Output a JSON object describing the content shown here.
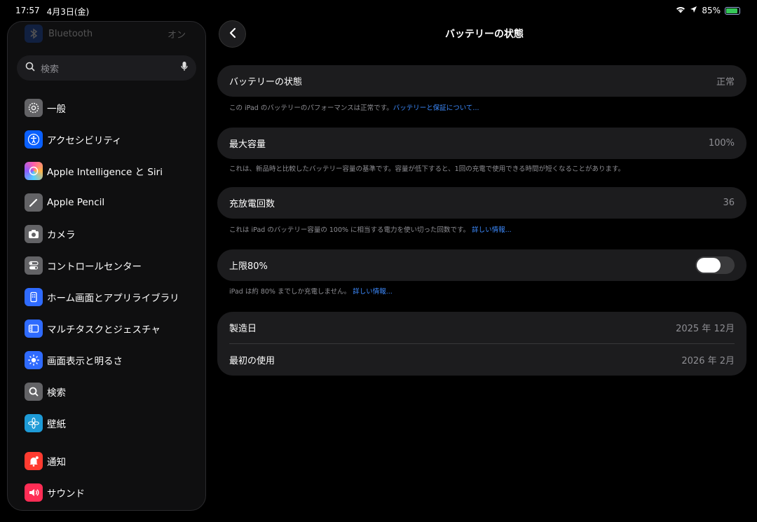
{
  "status": {
    "time": "17:57",
    "date": "4月3日(金)",
    "battery": "85%",
    "battery_level": 0.85
  },
  "sidebar": {
    "bluetooth": {
      "label": "Bluetooth",
      "value": "オン"
    },
    "search_placeholder": "検索",
    "items": [
      {
        "label": "一般",
        "icon": "gear-icon",
        "color": "#636366"
      },
      {
        "label": "アクセシビリティ",
        "icon": "accessibility-icon",
        "color": "#0a60ff"
      },
      {
        "label": "Apple Intelligence と Siri",
        "icon": "siri-icon",
        "color": "#e05ac0"
      },
      {
        "label": "Apple Pencil",
        "icon": "pencil-icon",
        "color": "#636366"
      },
      {
        "label": "カメラ",
        "icon": "camera-icon",
        "color": "#636366"
      },
      {
        "label": "コントロールセンター",
        "icon": "switches-icon",
        "color": "#636366"
      },
      {
        "label": "ホーム画面とアプリライブラリ",
        "icon": "home-screen-icon",
        "color": "#2f6bff"
      },
      {
        "label": "マルチタスクとジェスチャ",
        "icon": "multitask-icon",
        "color": "#2f6bff"
      },
      {
        "label": "画面表示と明るさ",
        "icon": "sun-icon",
        "color": "#2f6bff"
      },
      {
        "label": "検索",
        "icon": "magnifier-icon",
        "color": "#636366"
      },
      {
        "label": "壁紙",
        "icon": "flower-icon",
        "color": "#1e9bd7"
      },
      {
        "label": "通知",
        "icon": "bell-icon",
        "color": "#ff3b30"
      },
      {
        "label": "サウンド",
        "icon": "speaker-icon",
        "color": "#ff2d55"
      }
    ]
  },
  "main": {
    "title": "バッテリーの状態",
    "health": {
      "label": "バッテリーの状態",
      "value": "正常",
      "note": "この iPad のバッテリーのパフォーマンスは正常です。",
      "link": "バッテリーと保証について..."
    },
    "capacity": {
      "label": "最大容量",
      "value": "100%",
      "note": "これは、新品時と比較したバッテリー容量の基準です。容量が低下すると、1回の充電で使用できる時間が短くなることがあります。"
    },
    "cycles": {
      "label": "充放電回数",
      "value": "36",
      "note": "これは iPad のバッテリー容量の 100% に相当する電力を使い切った回数です。",
      "link": "詳しい情報..."
    },
    "limit": {
      "label": "上限80%",
      "enabled": false,
      "note": "iPad は約 80% までしか充電しません。",
      "link": "詳しい情報..."
    },
    "manufacture": {
      "label": "製造日",
      "value": "2025 年 12月"
    },
    "first_use": {
      "label": "最初の使用",
      "value": "2026 年 2月"
    }
  }
}
